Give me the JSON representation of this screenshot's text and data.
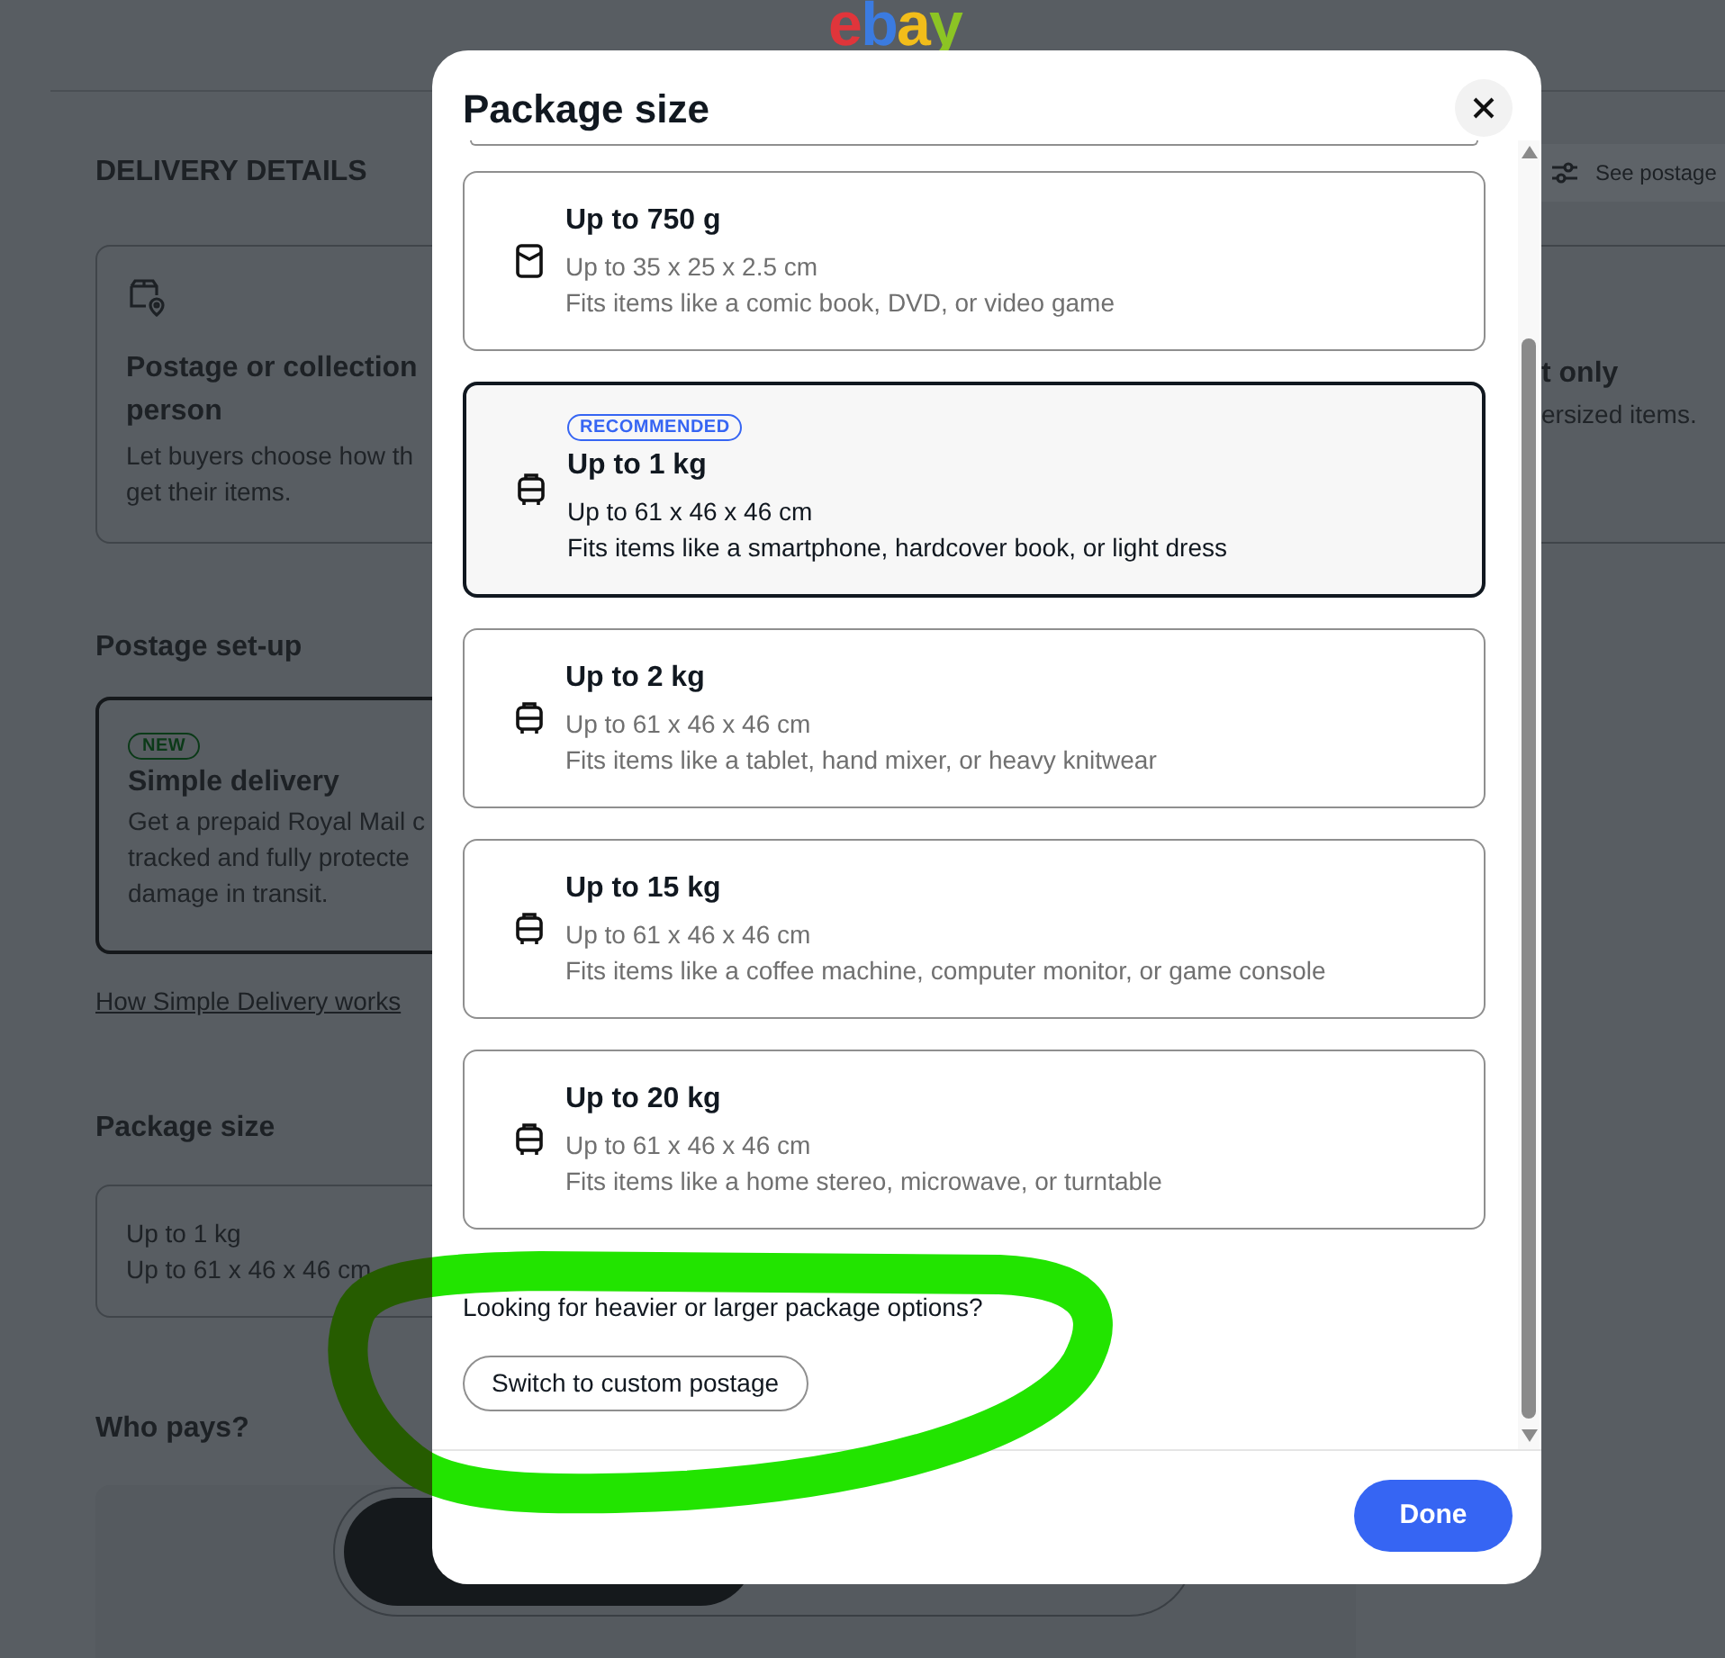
{
  "logo": "ebay",
  "page": {
    "section_title": "DELIVERY DETAILS",
    "postage_filter": "See postage",
    "delivery_cards": [
      {
        "title_lines": [
          "Postage or collection",
          "person"
        ],
        "description_lines": [
          "Let buyers choose how th",
          "get their items."
        ]
      },
      {
        "title_lines": [
          "t only"
        ],
        "description_lines": [
          "ersized items."
        ]
      }
    ],
    "postage_setup": {
      "heading": "Postage set-up",
      "card": {
        "badge": "NEW",
        "title": "Simple delivery",
        "description_lines": [
          "Get a prepaid Royal Mail c",
          "tracked and fully protecte",
          "damage in transit."
        ],
        "selected": true
      },
      "link": "How Simple Delivery works"
    },
    "package_size": {
      "heading": "Package size",
      "value": "Up to 1 kg",
      "detail": "Up to 61 x 46 x 46 cm"
    },
    "who_pays": {
      "heading": "Who pays?",
      "options": [
        {
          "selected": true
        },
        {
          "selected": false
        }
      ]
    }
  },
  "dialog": {
    "title": "Package size",
    "options": [
      {
        "kind": "envelope",
        "title": "Up to 750 g",
        "dimensions": "Up to 35 x 25 x 2.5 cm",
        "examples": "Fits items like a comic book, DVD, or video game",
        "selected": false
      },
      {
        "kind": "parcel",
        "badge": "RECOMMENDED",
        "title": "Up to 1 kg",
        "dimensions": "Up to 61 x 46 x 46 cm",
        "examples": "Fits items like a smartphone, hardcover book, or light dress",
        "selected": true
      },
      {
        "kind": "parcel",
        "title": "Up to 2 kg",
        "dimensions": "Up to 61 x 46 x 46 cm",
        "examples": "Fits items like a tablet, hand mixer, or heavy knitwear",
        "selected": false
      },
      {
        "kind": "parcel",
        "title": "Up to 15 kg",
        "dimensions": "Up to 61 x 46 x 46 cm",
        "examples": "Fits items like a coffee machine, computer monitor, or game console",
        "selected": false
      },
      {
        "kind": "parcel",
        "title": "Up to 20 kg",
        "dimensions": "Up to 61 x 46 x 46 cm",
        "examples": "Fits items like a home stereo, microwave, or turntable",
        "selected": false
      }
    ],
    "hint": "Looking for heavier or larger package options?",
    "custom_button": "Switch to custom postage",
    "done_button": "Done"
  }
}
